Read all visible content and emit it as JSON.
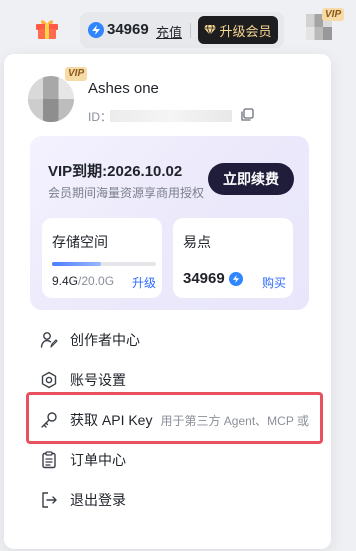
{
  "topbar": {
    "points": "34969",
    "recharge_label": "充值",
    "upgrade_label": "升级会员",
    "vip_badge": "VIP"
  },
  "profile": {
    "vip_badge": "VIP",
    "username": "Ashes one",
    "id_label": "ID："
  },
  "vip_card": {
    "expiry": "VIP到期:2026.10.02",
    "description": "会员期间海量资源享商用授权",
    "renew_label": "立即续费"
  },
  "storage": {
    "title": "存储空间",
    "used": "9.4G",
    "total": "/20.0G",
    "used_fraction": 0.47,
    "upgrade_label": "升级"
  },
  "points_card": {
    "title": "易点",
    "value": "34969",
    "buy_label": "购买"
  },
  "menu": [
    {
      "label": "创作者中心",
      "icon": "creator-icon",
      "hint": ""
    },
    {
      "label": "账号设置",
      "icon": "settings-icon",
      "hint": ""
    },
    {
      "label": "获取 API Key",
      "icon": "key-icon",
      "hint": "用于第三方 Agent、MCP 或"
    },
    {
      "label": "订单中心",
      "icon": "orders-icon",
      "hint": ""
    },
    {
      "label": "退出登录",
      "icon": "logout-icon",
      "hint": ""
    }
  ],
  "colors": {
    "accent_blue": "#2f6bff",
    "highlight": "#e8525f",
    "vip_gold": "#f6d693",
    "renew_dark": "#1f1d3a"
  }
}
